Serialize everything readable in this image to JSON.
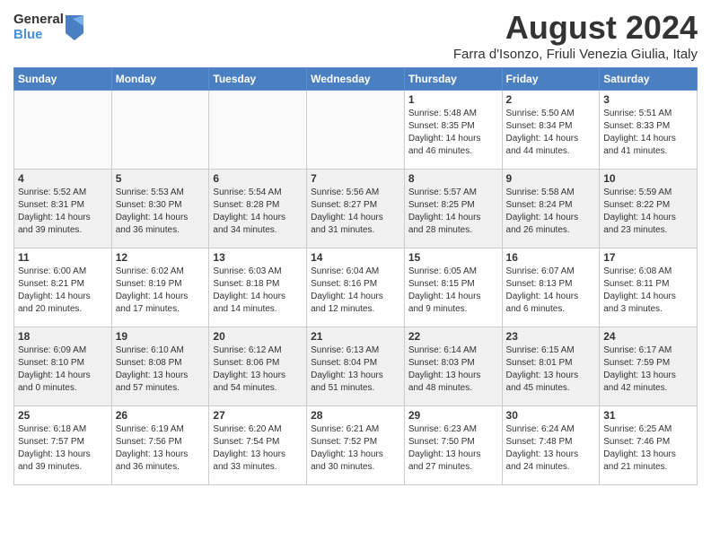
{
  "header": {
    "logo_general": "General",
    "logo_blue": "Blue",
    "month_title": "August 2024",
    "location": "Farra d'Isonzo, Friuli Venezia Giulia, Italy"
  },
  "weekdays": [
    "Sunday",
    "Monday",
    "Tuesday",
    "Wednesday",
    "Thursday",
    "Friday",
    "Saturday"
  ],
  "weeks": [
    [
      {
        "day": "",
        "info": ""
      },
      {
        "day": "",
        "info": ""
      },
      {
        "day": "",
        "info": ""
      },
      {
        "day": "",
        "info": ""
      },
      {
        "day": "1",
        "info": "Sunrise: 5:48 AM\nSunset: 8:35 PM\nDaylight: 14 hours\nand 46 minutes."
      },
      {
        "day": "2",
        "info": "Sunrise: 5:50 AM\nSunset: 8:34 PM\nDaylight: 14 hours\nand 44 minutes."
      },
      {
        "day": "3",
        "info": "Sunrise: 5:51 AM\nSunset: 8:33 PM\nDaylight: 14 hours\nand 41 minutes."
      }
    ],
    [
      {
        "day": "4",
        "info": "Sunrise: 5:52 AM\nSunset: 8:31 PM\nDaylight: 14 hours\nand 39 minutes."
      },
      {
        "day": "5",
        "info": "Sunrise: 5:53 AM\nSunset: 8:30 PM\nDaylight: 14 hours\nand 36 minutes."
      },
      {
        "day": "6",
        "info": "Sunrise: 5:54 AM\nSunset: 8:28 PM\nDaylight: 14 hours\nand 34 minutes."
      },
      {
        "day": "7",
        "info": "Sunrise: 5:56 AM\nSunset: 8:27 PM\nDaylight: 14 hours\nand 31 minutes."
      },
      {
        "day": "8",
        "info": "Sunrise: 5:57 AM\nSunset: 8:25 PM\nDaylight: 14 hours\nand 28 minutes."
      },
      {
        "day": "9",
        "info": "Sunrise: 5:58 AM\nSunset: 8:24 PM\nDaylight: 14 hours\nand 26 minutes."
      },
      {
        "day": "10",
        "info": "Sunrise: 5:59 AM\nSunset: 8:22 PM\nDaylight: 14 hours\nand 23 minutes."
      }
    ],
    [
      {
        "day": "11",
        "info": "Sunrise: 6:00 AM\nSunset: 8:21 PM\nDaylight: 14 hours\nand 20 minutes."
      },
      {
        "day": "12",
        "info": "Sunrise: 6:02 AM\nSunset: 8:19 PM\nDaylight: 14 hours\nand 17 minutes."
      },
      {
        "day": "13",
        "info": "Sunrise: 6:03 AM\nSunset: 8:18 PM\nDaylight: 14 hours\nand 14 minutes."
      },
      {
        "day": "14",
        "info": "Sunrise: 6:04 AM\nSunset: 8:16 PM\nDaylight: 14 hours\nand 12 minutes."
      },
      {
        "day": "15",
        "info": "Sunrise: 6:05 AM\nSunset: 8:15 PM\nDaylight: 14 hours\nand 9 minutes."
      },
      {
        "day": "16",
        "info": "Sunrise: 6:07 AM\nSunset: 8:13 PM\nDaylight: 14 hours\nand 6 minutes."
      },
      {
        "day": "17",
        "info": "Sunrise: 6:08 AM\nSunset: 8:11 PM\nDaylight: 14 hours\nand 3 minutes."
      }
    ],
    [
      {
        "day": "18",
        "info": "Sunrise: 6:09 AM\nSunset: 8:10 PM\nDaylight: 14 hours\nand 0 minutes."
      },
      {
        "day": "19",
        "info": "Sunrise: 6:10 AM\nSunset: 8:08 PM\nDaylight: 13 hours\nand 57 minutes."
      },
      {
        "day": "20",
        "info": "Sunrise: 6:12 AM\nSunset: 8:06 PM\nDaylight: 13 hours\nand 54 minutes."
      },
      {
        "day": "21",
        "info": "Sunrise: 6:13 AM\nSunset: 8:04 PM\nDaylight: 13 hours\nand 51 minutes."
      },
      {
        "day": "22",
        "info": "Sunrise: 6:14 AM\nSunset: 8:03 PM\nDaylight: 13 hours\nand 48 minutes."
      },
      {
        "day": "23",
        "info": "Sunrise: 6:15 AM\nSunset: 8:01 PM\nDaylight: 13 hours\nand 45 minutes."
      },
      {
        "day": "24",
        "info": "Sunrise: 6:17 AM\nSunset: 7:59 PM\nDaylight: 13 hours\nand 42 minutes."
      }
    ],
    [
      {
        "day": "25",
        "info": "Sunrise: 6:18 AM\nSunset: 7:57 PM\nDaylight: 13 hours\nand 39 minutes."
      },
      {
        "day": "26",
        "info": "Sunrise: 6:19 AM\nSunset: 7:56 PM\nDaylight: 13 hours\nand 36 minutes."
      },
      {
        "day": "27",
        "info": "Sunrise: 6:20 AM\nSunset: 7:54 PM\nDaylight: 13 hours\nand 33 minutes."
      },
      {
        "day": "28",
        "info": "Sunrise: 6:21 AM\nSunset: 7:52 PM\nDaylight: 13 hours\nand 30 minutes."
      },
      {
        "day": "29",
        "info": "Sunrise: 6:23 AM\nSunset: 7:50 PM\nDaylight: 13 hours\nand 27 minutes."
      },
      {
        "day": "30",
        "info": "Sunrise: 6:24 AM\nSunset: 7:48 PM\nDaylight: 13 hours\nand 24 minutes."
      },
      {
        "day": "31",
        "info": "Sunrise: 6:25 AM\nSunset: 7:46 PM\nDaylight: 13 hours\nand 21 minutes."
      }
    ]
  ]
}
